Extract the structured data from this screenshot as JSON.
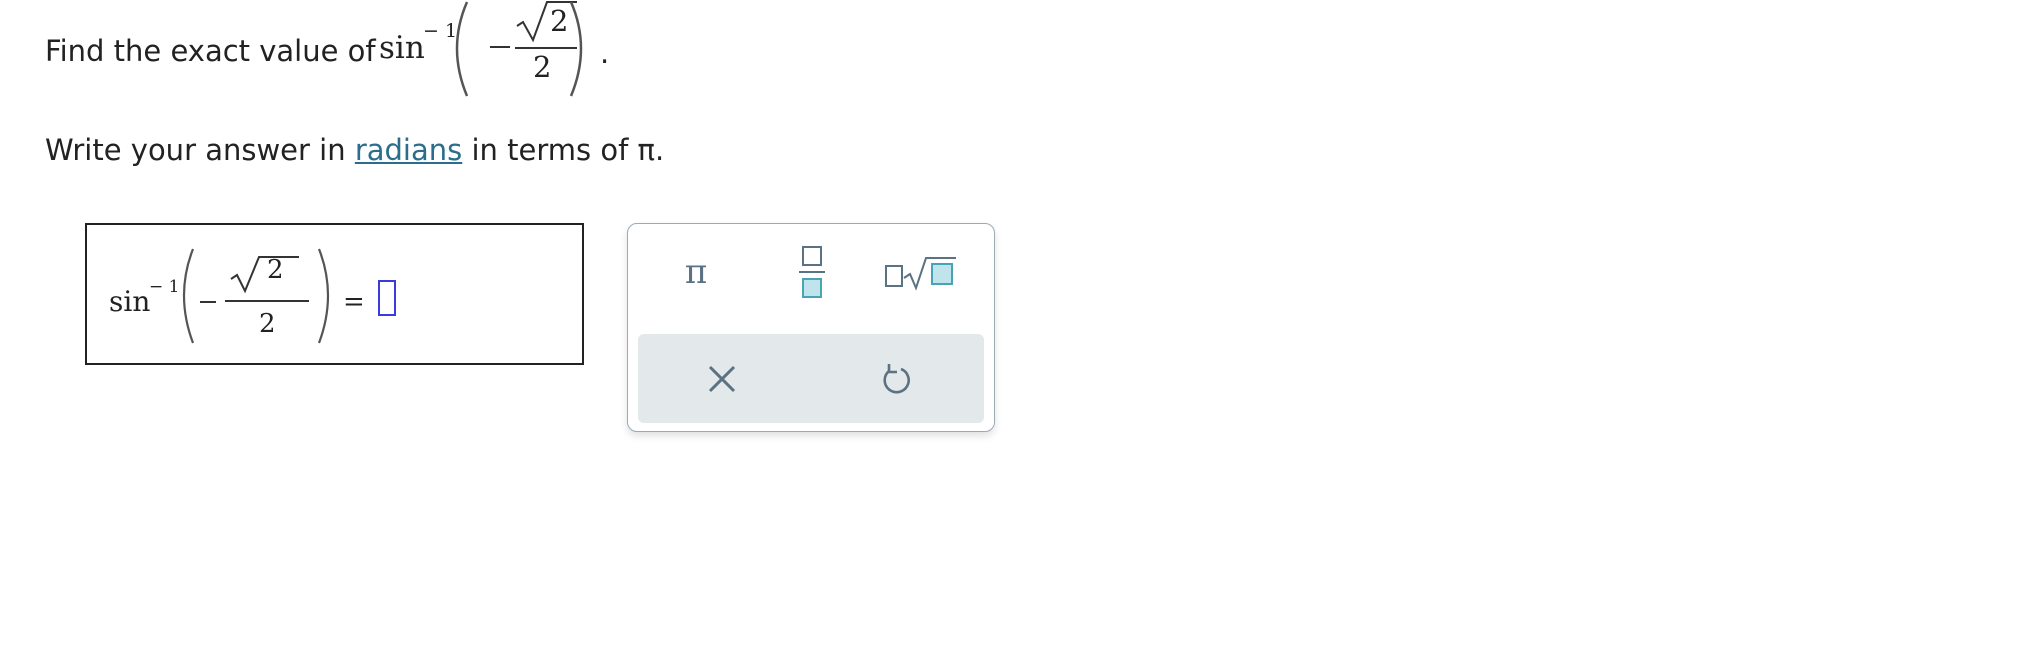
{
  "question": {
    "prefix": "Find the exact value of ",
    "function": "sin",
    "exponent": "− 1",
    "sign": "−",
    "radicand": "2",
    "denominator": "2",
    "period": "."
  },
  "instruction": {
    "before": "Write your answer in ",
    "link": "radians",
    "after": " in terms of π."
  },
  "answer": {
    "function": "sin",
    "exponent": "− 1",
    "sign": "−",
    "radicand": "2",
    "denominator": "2",
    "equals": "=",
    "value": ""
  },
  "palette": {
    "pi": "π",
    "buttons": [
      "pi-button",
      "fraction-button",
      "nth-root-button"
    ],
    "actions": [
      "clear-button",
      "undo-button"
    ],
    "accent_color": "#4aa3b5",
    "icon_color": "#5a7282"
  }
}
